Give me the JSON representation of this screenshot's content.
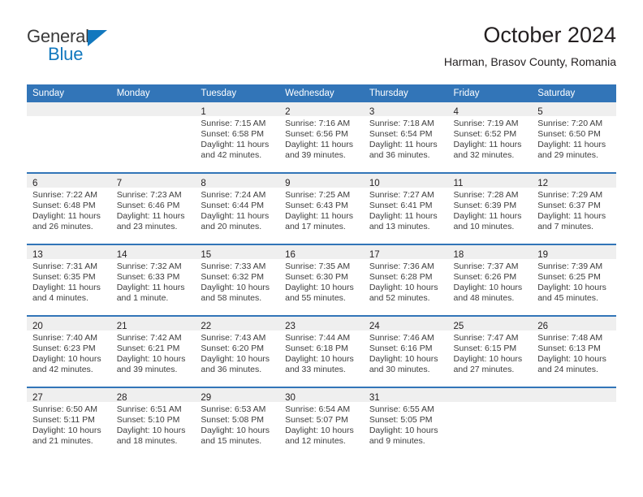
{
  "logo": {
    "word_top": "General",
    "word_bottom": "Blue",
    "triangle_color": "#1278be",
    "icon": "general-blue-logo"
  },
  "header": {
    "month_title": "October 2024",
    "location": "Harman, Brasov County, Romania"
  },
  "theme": {
    "header_blue": "#3275b8",
    "daynum_band": "#efefef",
    "text": "#231f20"
  },
  "weekdays": [
    "Sunday",
    "Monday",
    "Tuesday",
    "Wednesday",
    "Thursday",
    "Friday",
    "Saturday"
  ],
  "weeks": [
    [
      {
        "day": "",
        "empty": true
      },
      {
        "day": "",
        "empty": true
      },
      {
        "day": "1",
        "sunrise": "Sunrise: 7:15 AM",
        "sunset": "Sunset: 6:58 PM",
        "daylight_1": "Daylight: 11 hours",
        "daylight_2": "and 42 minutes."
      },
      {
        "day": "2",
        "sunrise": "Sunrise: 7:16 AM",
        "sunset": "Sunset: 6:56 PM",
        "daylight_1": "Daylight: 11 hours",
        "daylight_2": "and 39 minutes."
      },
      {
        "day": "3",
        "sunrise": "Sunrise: 7:18 AM",
        "sunset": "Sunset: 6:54 PM",
        "daylight_1": "Daylight: 11 hours",
        "daylight_2": "and 36 minutes."
      },
      {
        "day": "4",
        "sunrise": "Sunrise: 7:19 AM",
        "sunset": "Sunset: 6:52 PM",
        "daylight_1": "Daylight: 11 hours",
        "daylight_2": "and 32 minutes."
      },
      {
        "day": "5",
        "sunrise": "Sunrise: 7:20 AM",
        "sunset": "Sunset: 6:50 PM",
        "daylight_1": "Daylight: 11 hours",
        "daylight_2": "and 29 minutes."
      }
    ],
    [
      {
        "day": "6",
        "sunrise": "Sunrise: 7:22 AM",
        "sunset": "Sunset: 6:48 PM",
        "daylight_1": "Daylight: 11 hours",
        "daylight_2": "and 26 minutes."
      },
      {
        "day": "7",
        "sunrise": "Sunrise: 7:23 AM",
        "sunset": "Sunset: 6:46 PM",
        "daylight_1": "Daylight: 11 hours",
        "daylight_2": "and 23 minutes."
      },
      {
        "day": "8",
        "sunrise": "Sunrise: 7:24 AM",
        "sunset": "Sunset: 6:44 PM",
        "daylight_1": "Daylight: 11 hours",
        "daylight_2": "and 20 minutes."
      },
      {
        "day": "9",
        "sunrise": "Sunrise: 7:25 AM",
        "sunset": "Sunset: 6:43 PM",
        "daylight_1": "Daylight: 11 hours",
        "daylight_2": "and 17 minutes."
      },
      {
        "day": "10",
        "sunrise": "Sunrise: 7:27 AM",
        "sunset": "Sunset: 6:41 PM",
        "daylight_1": "Daylight: 11 hours",
        "daylight_2": "and 13 minutes."
      },
      {
        "day": "11",
        "sunrise": "Sunrise: 7:28 AM",
        "sunset": "Sunset: 6:39 PM",
        "daylight_1": "Daylight: 11 hours",
        "daylight_2": "and 10 minutes."
      },
      {
        "day": "12",
        "sunrise": "Sunrise: 7:29 AM",
        "sunset": "Sunset: 6:37 PM",
        "daylight_1": "Daylight: 11 hours",
        "daylight_2": "and 7 minutes."
      }
    ],
    [
      {
        "day": "13",
        "sunrise": "Sunrise: 7:31 AM",
        "sunset": "Sunset: 6:35 PM",
        "daylight_1": "Daylight: 11 hours",
        "daylight_2": "and 4 minutes."
      },
      {
        "day": "14",
        "sunrise": "Sunrise: 7:32 AM",
        "sunset": "Sunset: 6:33 PM",
        "daylight_1": "Daylight: 11 hours",
        "daylight_2": "and 1 minute."
      },
      {
        "day": "15",
        "sunrise": "Sunrise: 7:33 AM",
        "sunset": "Sunset: 6:32 PM",
        "daylight_1": "Daylight: 10 hours",
        "daylight_2": "and 58 minutes."
      },
      {
        "day": "16",
        "sunrise": "Sunrise: 7:35 AM",
        "sunset": "Sunset: 6:30 PM",
        "daylight_1": "Daylight: 10 hours",
        "daylight_2": "and 55 minutes."
      },
      {
        "day": "17",
        "sunrise": "Sunrise: 7:36 AM",
        "sunset": "Sunset: 6:28 PM",
        "daylight_1": "Daylight: 10 hours",
        "daylight_2": "and 52 minutes."
      },
      {
        "day": "18",
        "sunrise": "Sunrise: 7:37 AM",
        "sunset": "Sunset: 6:26 PM",
        "daylight_1": "Daylight: 10 hours",
        "daylight_2": "and 48 minutes."
      },
      {
        "day": "19",
        "sunrise": "Sunrise: 7:39 AM",
        "sunset": "Sunset: 6:25 PM",
        "daylight_1": "Daylight: 10 hours",
        "daylight_2": "and 45 minutes."
      }
    ],
    [
      {
        "day": "20",
        "sunrise": "Sunrise: 7:40 AM",
        "sunset": "Sunset: 6:23 PM",
        "daylight_1": "Daylight: 10 hours",
        "daylight_2": "and 42 minutes."
      },
      {
        "day": "21",
        "sunrise": "Sunrise: 7:42 AM",
        "sunset": "Sunset: 6:21 PM",
        "daylight_1": "Daylight: 10 hours",
        "daylight_2": "and 39 minutes."
      },
      {
        "day": "22",
        "sunrise": "Sunrise: 7:43 AM",
        "sunset": "Sunset: 6:20 PM",
        "daylight_1": "Daylight: 10 hours",
        "daylight_2": "and 36 minutes."
      },
      {
        "day": "23",
        "sunrise": "Sunrise: 7:44 AM",
        "sunset": "Sunset: 6:18 PM",
        "daylight_1": "Daylight: 10 hours",
        "daylight_2": "and 33 minutes."
      },
      {
        "day": "24",
        "sunrise": "Sunrise: 7:46 AM",
        "sunset": "Sunset: 6:16 PM",
        "daylight_1": "Daylight: 10 hours",
        "daylight_2": "and 30 minutes."
      },
      {
        "day": "25",
        "sunrise": "Sunrise: 7:47 AM",
        "sunset": "Sunset: 6:15 PM",
        "daylight_1": "Daylight: 10 hours",
        "daylight_2": "and 27 minutes."
      },
      {
        "day": "26",
        "sunrise": "Sunrise: 7:48 AM",
        "sunset": "Sunset: 6:13 PM",
        "daylight_1": "Daylight: 10 hours",
        "daylight_2": "and 24 minutes."
      }
    ],
    [
      {
        "day": "27",
        "sunrise": "Sunrise: 6:50 AM",
        "sunset": "Sunset: 5:11 PM",
        "daylight_1": "Daylight: 10 hours",
        "daylight_2": "and 21 minutes."
      },
      {
        "day": "28",
        "sunrise": "Sunrise: 6:51 AM",
        "sunset": "Sunset: 5:10 PM",
        "daylight_1": "Daylight: 10 hours",
        "daylight_2": "and 18 minutes."
      },
      {
        "day": "29",
        "sunrise": "Sunrise: 6:53 AM",
        "sunset": "Sunset: 5:08 PM",
        "daylight_1": "Daylight: 10 hours",
        "daylight_2": "and 15 minutes."
      },
      {
        "day": "30",
        "sunrise": "Sunrise: 6:54 AM",
        "sunset": "Sunset: 5:07 PM",
        "daylight_1": "Daylight: 10 hours",
        "daylight_2": "and 12 minutes."
      },
      {
        "day": "31",
        "sunrise": "Sunrise: 6:55 AM",
        "sunset": "Sunset: 5:05 PM",
        "daylight_1": "Daylight: 10 hours",
        "daylight_2": "and 9 minutes."
      },
      {
        "day": "",
        "empty": true
      },
      {
        "day": "",
        "empty": true
      }
    ]
  ]
}
